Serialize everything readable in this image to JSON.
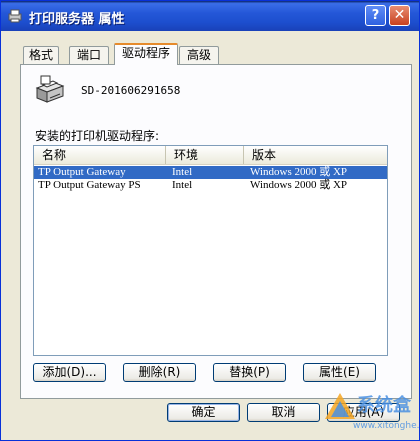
{
  "window": {
    "title": "打印服务器 属性"
  },
  "titlebar": {
    "help": "?",
    "close": "✕"
  },
  "tabs": [
    {
      "label": "格式"
    },
    {
      "label": "端口"
    },
    {
      "label": "驱动程序"
    },
    {
      "label": "高级"
    }
  ],
  "server": {
    "name": "SD-201606291658"
  },
  "drivers": {
    "label": "安装的打印机驱动程序:",
    "columns": [
      "名称",
      "环境",
      "版本"
    ],
    "rows": [
      {
        "name": "TP Output Gateway",
        "env": "Intel",
        "version": "Windows 2000 或 XP",
        "selected": true
      },
      {
        "name": "TP Output Gateway PS",
        "env": "Intel",
        "version": "Windows 2000 或 XP",
        "selected": false
      }
    ]
  },
  "buttons": {
    "add": "添加(D)...",
    "remove": "删除(R)",
    "replace": "替换(P)",
    "properties": "属性(E)",
    "ok": "确定",
    "cancel": "取消",
    "apply": "应用(A)"
  },
  "watermark": {
    "text": "系统盒",
    "url": "www.xitonghe.com"
  },
  "colors": {
    "titlebar": "#2457d8",
    "selection": "#316ac5",
    "tab_accent": "#e68b2c"
  }
}
